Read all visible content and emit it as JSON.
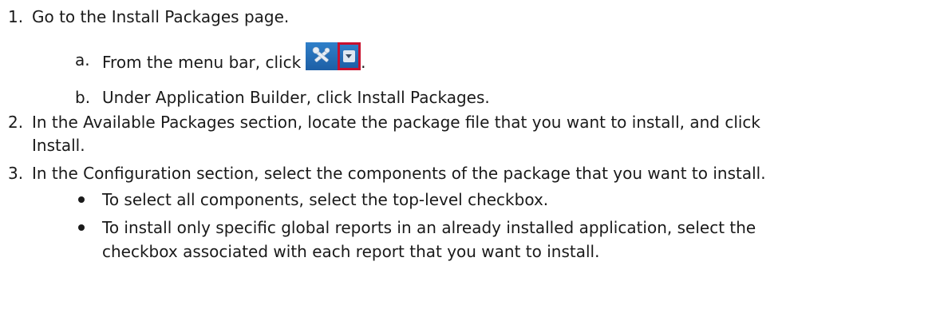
{
  "steps": [
    {
      "number": "1.",
      "text": "Go to the Install Packages page.",
      "substeps": [
        {
          "letter": "a.",
          "text_before": "From the menu bar, click",
          "text_after": "."
        },
        {
          "letter": "b.",
          "text": "Under Application Builder, click Install Packages."
        }
      ]
    },
    {
      "number": "2.",
      "text_line1": "In the Available Packages section, locate the package file that you want to install, and click",
      "text_line2": "Install."
    },
    {
      "number": "3.",
      "text": "In the Configuration section, select the components of the package that you want to install.",
      "bullets": [
        {
          "text": "To select all components, select the top-level checkbox."
        },
        {
          "text_line1": "To install only specific global reports in an already installed application, select the",
          "text_line2": "checkbox associated with each report that you want to install."
        }
      ]
    }
  ],
  "icons": {
    "toolbar_tools": "tools-icon",
    "toolbar_dropdown": "chevron-down-icon",
    "highlight_color": "#c8102e",
    "button_color": "#2f7fc9"
  }
}
